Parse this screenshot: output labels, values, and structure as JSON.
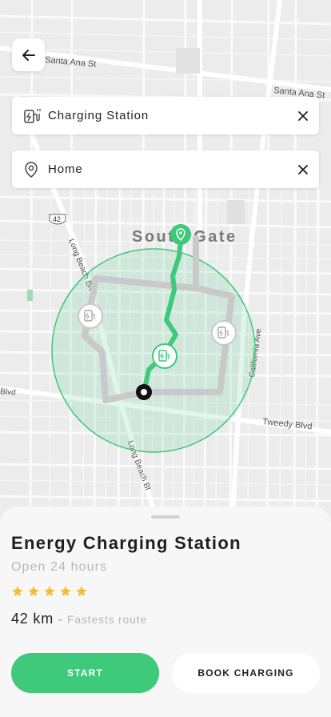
{
  "map": {
    "labels": {
      "street_1": "Santa Ana St",
      "street_2": "Santa Ana St",
      "street_3": "Long Beach Blvd",
      "street_4": "California Ave",
      "street_5": "Tweedy Blvd",
      "street_6": "Long Beach Bl",
      "street_7": "Blvd",
      "highway": "42",
      "city": "South Gate"
    },
    "colors": {
      "route": "#3ec97b",
      "radius_fill": "#3ec97b",
      "alt_route": "#c9c9c9"
    }
  },
  "search": {
    "from": {
      "value": "Charging Station",
      "icon": "charging-station-icon"
    },
    "to": {
      "value": "Home",
      "icon": "location-pin-icon"
    }
  },
  "sheet": {
    "title": "Energy Charging Station",
    "hours": "Open 24 hours",
    "rating": 5,
    "distance": "42 km",
    "separator": "-",
    "route_note": "Fastests route",
    "start_label": "START",
    "book_label": "BOOK CHARGING"
  },
  "colors": {
    "accent": "#3ec97b",
    "star": "#f5bd32"
  }
}
